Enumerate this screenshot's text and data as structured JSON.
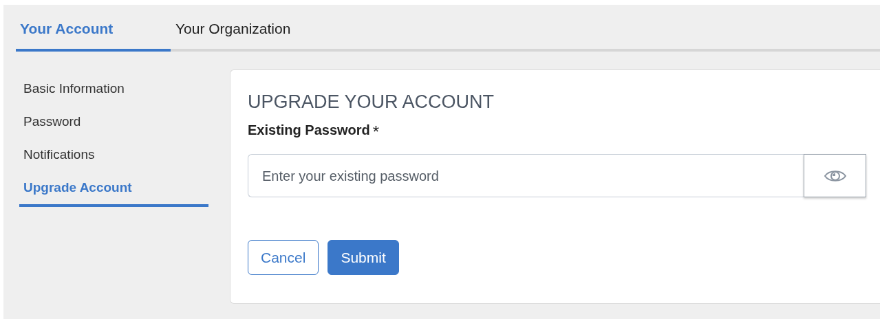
{
  "tabs": [
    {
      "label": "Your Account",
      "selected": true
    },
    {
      "label": "Your Organization",
      "selected": false
    }
  ],
  "sidebar": {
    "items": [
      {
        "label": "Basic Information",
        "selected": false
      },
      {
        "label": "Password",
        "selected": false
      },
      {
        "label": "Notifications",
        "selected": false
      },
      {
        "label": "Upgrade Account",
        "selected": true
      }
    ]
  },
  "form": {
    "title": "UPGRADE YOUR ACCOUNT",
    "field": {
      "label": "Existing Password",
      "required_mark": "*",
      "placeholder": "Enter your existing password"
    },
    "buttons": [
      {
        "label": "Cancel",
        "kind": "secondary"
      },
      {
        "label": "Submit",
        "kind": "primary"
      }
    ]
  }
}
